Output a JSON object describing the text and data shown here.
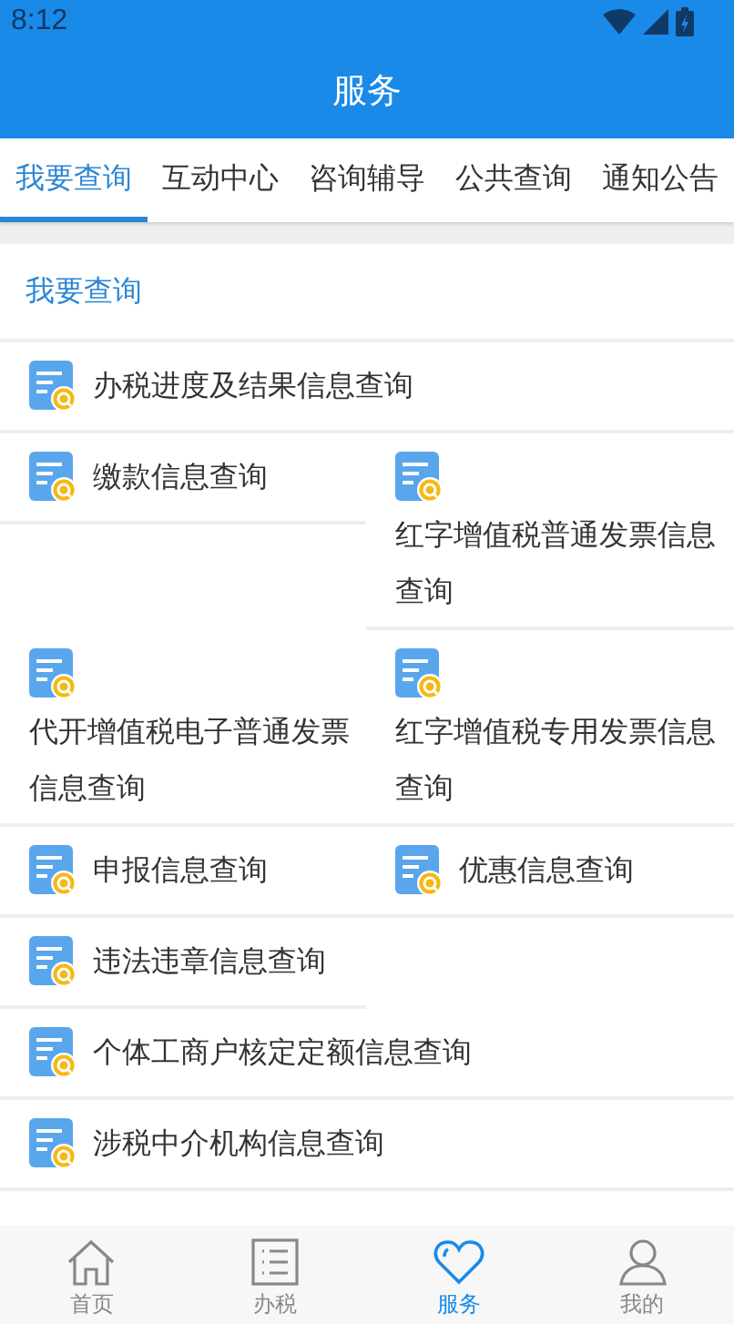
{
  "status_bar": {
    "time": "8:12"
  },
  "header": {
    "title": "服务"
  },
  "tabs": [
    {
      "label": "我要查询",
      "selected": true
    },
    {
      "label": "互动中心",
      "selected": false
    },
    {
      "label": "咨询辅导",
      "selected": false
    },
    {
      "label": "公共查询",
      "selected": false
    },
    {
      "label": "通知公告",
      "selected": false
    }
  ],
  "section": {
    "title": "我要查询"
  },
  "rows": [
    [
      {
        "label": "办税进度及结果信息查询",
        "kind": "inline"
      }
    ],
    [
      {
        "label": "缴款信息查询",
        "kind": "inline"
      },
      {
        "label": "红字增值税普通发票信息查询",
        "kind": "stacked"
      }
    ],
    [
      {
        "label": "代开增值税电子普通发票信息查询",
        "kind": "stacked"
      },
      {
        "label": "红字增值税专用发票信息查询",
        "kind": "stacked"
      }
    ],
    [
      {
        "label": "申报信息查询",
        "kind": "inline"
      },
      {
        "label": "优惠信息查询",
        "kind": "inline"
      }
    ],
    [
      {
        "label": "违法违章信息查询",
        "kind": "inline"
      }
    ],
    [
      {
        "label": "个体工商户核定定额信息查询",
        "kind": "inline"
      }
    ],
    [
      {
        "label": "涉税中介机构信息查询",
        "kind": "inline"
      }
    ]
  ],
  "bottom_nav": [
    {
      "label": "首页",
      "kind": "home",
      "selected": false
    },
    {
      "label": "办税",
      "kind": "list",
      "selected": false
    },
    {
      "label": "服务",
      "kind": "heart",
      "selected": true
    },
    {
      "label": "我的",
      "kind": "person",
      "selected": false
    }
  ]
}
